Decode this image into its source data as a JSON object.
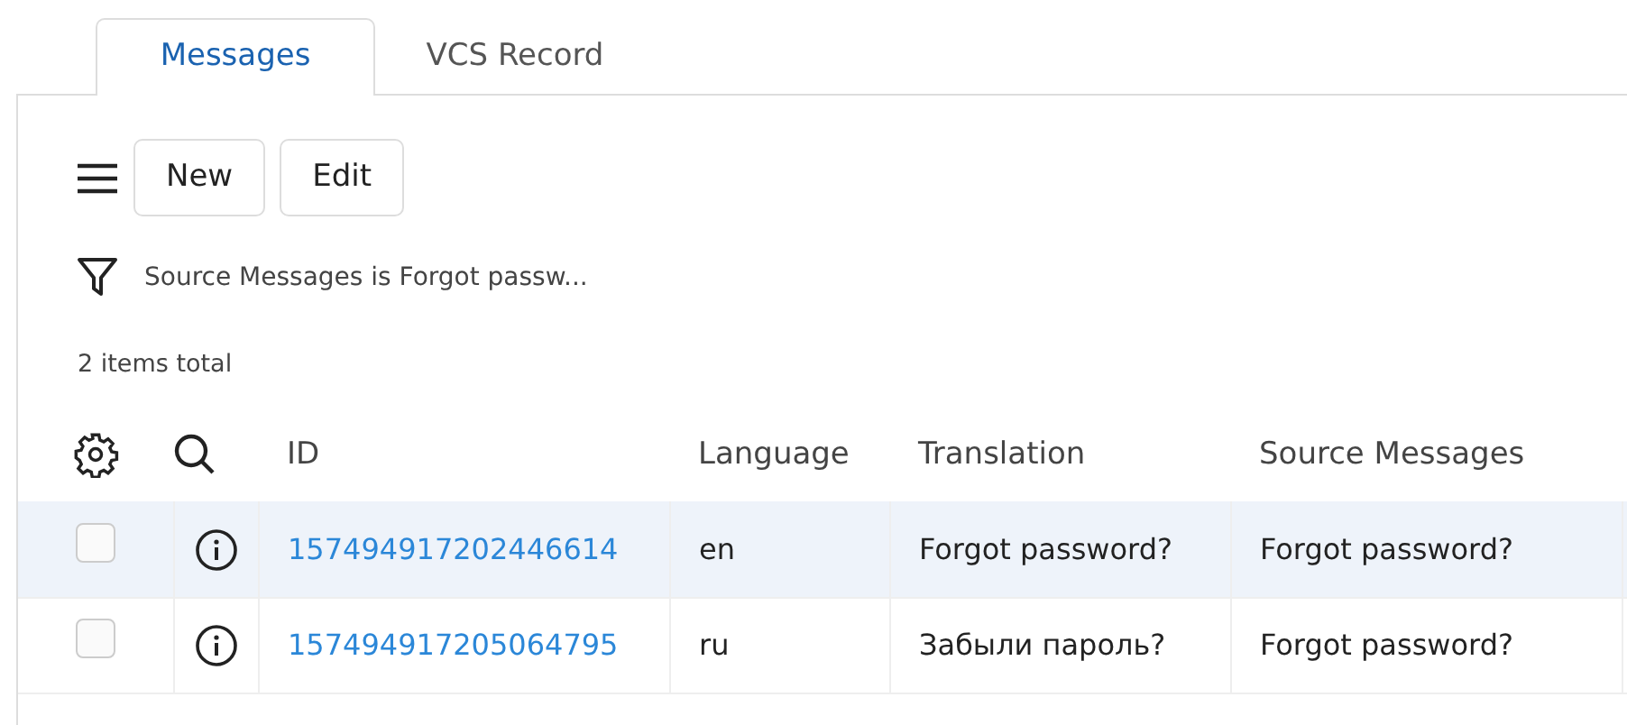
{
  "tabs": [
    {
      "label": "Messages",
      "selected": true
    },
    {
      "label": "VCS Record",
      "selected": false
    }
  ],
  "toolbar": {
    "buttons": [
      "New",
      "Edit"
    ]
  },
  "filter": {
    "text": "Source Messages is Forgot passw..."
  },
  "total": "2 items total",
  "table": {
    "columns": [
      "ID",
      "Language",
      "Translation",
      "Source Messages"
    ],
    "rows": [
      {
        "checked": false,
        "highlighted": true,
        "cells": [
          "157494917202446614",
          "en",
          "Forgot password?",
          "Forgot password?"
        ]
      },
      {
        "checked": false,
        "highlighted": false,
        "cells": [
          "157494917205064795",
          "ru",
          "Забыли пароль?",
          "Forgot password?"
        ]
      }
    ]
  }
}
